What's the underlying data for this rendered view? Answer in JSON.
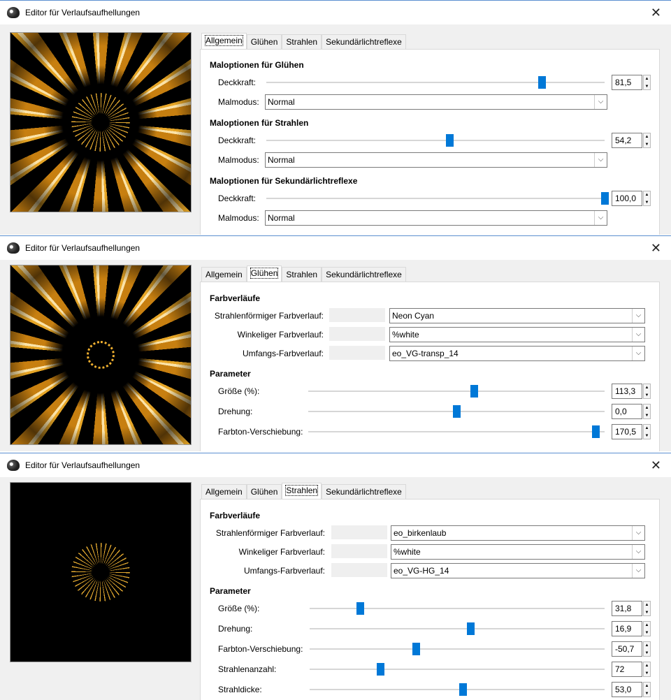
{
  "window_title": "Editor für Verlaufsaufhellungen",
  "tabs": [
    "Allgemein",
    "Glühen",
    "Strahlen",
    "Sekundärlichtreflexe"
  ],
  "panel1": {
    "active_tab": 0,
    "sections": [
      {
        "title": "Maloptionen für Glühen",
        "opacity_label": "Deckkraft:",
        "opacity": "81,5",
        "opacity_fraction": 0.815,
        "mode_label": "Malmodus:",
        "mode": "Normal"
      },
      {
        "title": "Maloptionen für Strahlen",
        "opacity_label": "Deckkraft:",
        "opacity": "54,2",
        "opacity_fraction": 0.542,
        "mode_label": "Malmodus:",
        "mode": "Normal"
      },
      {
        "title": "Maloptionen für Sekundärlichtreflexe",
        "opacity_label": "Deckkraft:",
        "opacity": "100,0",
        "opacity_fraction": 1.0,
        "mode_label": "Malmodus:",
        "mode": "Normal"
      }
    ]
  },
  "panel2": {
    "active_tab": 1,
    "gradients_title": "Farbverläufe",
    "gradients": [
      {
        "label": "Strahlenförmiger Farbverlauf:",
        "value": "Neon Cyan"
      },
      {
        "label": "Winkeliger Farbverlauf:",
        "value": "%white"
      },
      {
        "label": "Umfangs-Farbverlauf:",
        "value": "eo_VG-transp_14"
      }
    ],
    "params_title": "Parameter",
    "params": [
      {
        "label": "Größe (%):",
        "value": "113,3",
        "fraction": 0.56
      },
      {
        "label": "Drehung:",
        "value": "0,0",
        "fraction": 0.5
      },
      {
        "label": "Farbton-Verschiebung:",
        "value": "170,5",
        "fraction": 0.97
      }
    ]
  },
  "panel3": {
    "active_tab": 2,
    "gradients_title": "Farbverläufe",
    "gradients": [
      {
        "label": "Strahlenförmiger Farbverlauf:",
        "value": "eo_birkenlaub"
      },
      {
        "label": "Winkeliger Farbverlauf:",
        "value": "%white"
      },
      {
        "label": "Umfangs-Farbverlauf:",
        "value": "eo_VG-HG_14"
      }
    ],
    "params_title": "Parameter",
    "params": [
      {
        "label": "Größe (%):",
        "value": "31,8",
        "fraction": 0.17
      },
      {
        "label": "Drehung:",
        "value": "16,9",
        "fraction": 0.545
      },
      {
        "label": "Farbton-Verschiebung:",
        "value": "-50,7",
        "fraction": 0.36
      },
      {
        "label": "Strahlenanzahl:",
        "value": "72",
        "fraction": 0.24
      },
      {
        "label": "Strahldicke:",
        "value": "53,0",
        "fraction": 0.52
      }
    ]
  },
  "colors": {
    "accent": "#0078d7",
    "ray_gold": "#e6a526"
  }
}
